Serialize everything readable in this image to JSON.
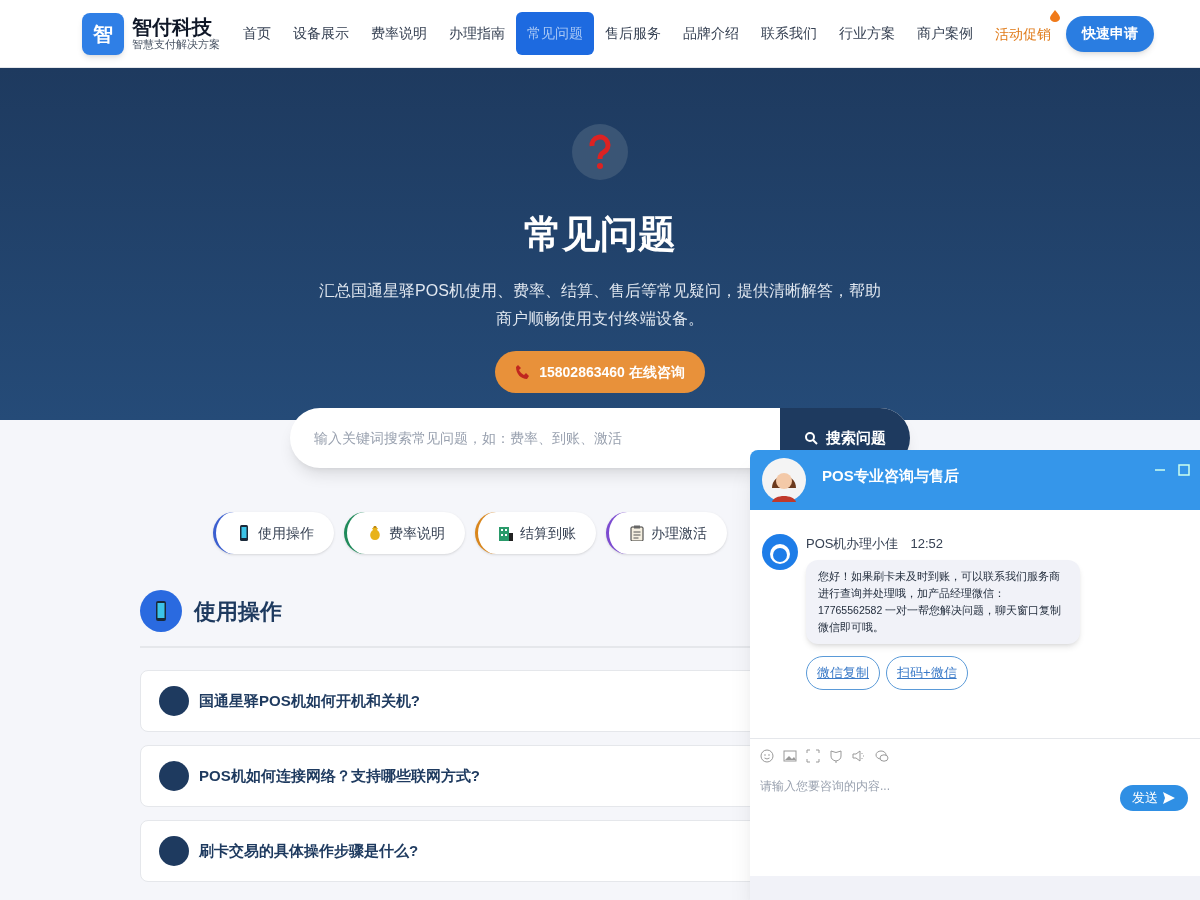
{
  "brand": {
    "logo_char": "智",
    "name": "智付科技",
    "tagline": "智慧支付解决方案"
  },
  "nav": [
    {
      "label": "首页",
      "selected": false,
      "kind": "link"
    },
    {
      "label": "设备展示",
      "selected": false,
      "kind": "link"
    },
    {
      "label": "费率说明",
      "selected": false,
      "kind": "link"
    },
    {
      "label": "办理指南",
      "selected": false,
      "kind": "link"
    },
    {
      "label": "常见问题",
      "selected": true,
      "kind": "link"
    },
    {
      "label": "售后服务",
      "selected": false,
      "kind": "link"
    },
    {
      "label": "品牌介绍",
      "selected": false,
      "kind": "link"
    },
    {
      "label": "联系我们",
      "selected": false,
      "kind": "link"
    },
    {
      "label": "行业方案",
      "selected": false,
      "kind": "link"
    },
    {
      "label": "商户案例",
      "selected": false,
      "kind": "link"
    },
    {
      "label": "活动促销",
      "selected": false,
      "kind": "promo"
    }
  ],
  "apply_button": "快速申请",
  "hero": {
    "title": "常见问题",
    "subtitle": "汇总国通星驿POS机使用、费率、结算、售后等常见疑问，提供清晰解答，帮助商户顺畅使用支付终端设备。",
    "call_button": "15802863460 在线咨询",
    "search": {
      "placeholder": "输入关键词搜索常见问题，如：费率、到账、激活",
      "button": "搜索问题"
    }
  },
  "categories": [
    {
      "label": "使用操作",
      "color": "#3b5fd0"
    },
    {
      "label": "费率说明",
      "color": "#1f8a5a"
    },
    {
      "label": "结算到账",
      "color": "#d9861c"
    },
    {
      "label": "办理激活",
      "color": "#7c4bd1"
    }
  ],
  "section": {
    "title": "使用操作",
    "questions": [
      "国通星驿POS机如何开机和关机?",
      "POS机如何连接网络？支持哪些联网方式?",
      "刷卡交易的具体操作步骤是什么?"
    ]
  },
  "chat": {
    "title": "POS专业咨询与售后",
    "agent": "POS机办理小佳",
    "time": "12:52",
    "message": "您好！如果刷卡未及时到账，可以联系我们服务商进行查询并处理哦，加产品经理微信：17765562582 一对一帮您解决问题，聊天窗口复制微信即可哦。",
    "quick_replies": [
      "微信复制",
      "扫码+微信"
    ],
    "input_placeholder": "请输入您要咨询的内容...",
    "send_button": "发送"
  }
}
